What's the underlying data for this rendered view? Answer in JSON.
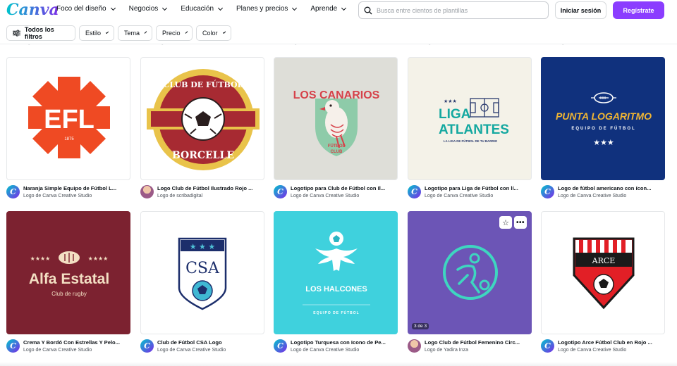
{
  "brand": {
    "name": "Canva"
  },
  "nav": [
    {
      "label": "Foco del diseño"
    },
    {
      "label": "Negocios"
    },
    {
      "label": "Educación"
    },
    {
      "label": "Planes y precios"
    },
    {
      "label": "Aprende"
    }
  ],
  "search": {
    "placeholder": "Busca entre cientos de plantillas",
    "icon": "search-icon"
  },
  "auth": {
    "login_label": "Iniciar sesión",
    "register_label": "Regístrate"
  },
  "filters": {
    "all_label": "Todos los filtros",
    "style_label": "Estilo",
    "theme_label": "Tema",
    "price_label": "Precio",
    "color_label": "Color"
  },
  "remnants": [
    "Logo de ... Studio",
    "Logo de Canva Creative Studio",
    "Logo de Canva Creative Studio",
    "Logo de Canva Creative Studio",
    "Logo de Canva Creative Studio"
  ],
  "cards": [
    {
      "title": "Naranja Simple Equipo de Fútbol L...",
      "author": "Logo de Canva Creative Studio",
      "thumb": {
        "text1": "EFL",
        "text2": "1875"
      }
    },
    {
      "title": "Logo Club de Fútbol Ilustrado Rojo ...",
      "author": "Logo de scribadigital",
      "thumb": {
        "text1": "CLUB DE FÚTBOL",
        "text2": "BORCELLE"
      }
    },
    {
      "title": "Logotipo para Club de Fútbol con Il...",
      "author": "Logo de Canva Creative Studio",
      "thumb": {
        "text1": "LOS CANARIOS",
        "text2": "FÚTBOL",
        "text3": "CLUB"
      }
    },
    {
      "title": "Logotipo para Liga de Fútbol con lí...",
      "author": "Logo de Canva Creative Studio",
      "thumb": {
        "text1": "LIGA",
        "text2": "ATLANTES",
        "text3": "LA LIGA DE FÚTBOL DE TU BARRIO"
      }
    },
    {
      "title": "Logo de fútbol americano con ícon...",
      "author": "Logo de Canva Creative Studio",
      "thumb": {
        "text1": "PUNTA LOGARITMO",
        "text2": "EQUIPO DE FÚTBOL"
      }
    },
    {
      "title": "Crema Y Bordó Con Estrellas Y Pelo...",
      "author": "Logo de Canva Creative Studio",
      "thumb": {
        "text1": "Alfa Estatal",
        "text2": "Club de rugby"
      }
    },
    {
      "title": "Club de Fútbol CSA Logo",
      "author": "Logo de Canva Creative Studio",
      "thumb": {
        "text1": "CSA"
      }
    },
    {
      "title": "Logotipo Turquesa con Icono de Pe...",
      "author": "Logo de Canva Creative Studio",
      "thumb": {
        "text1": "LOS HALCONES",
        "text2": "EQUIPO DE FÚTBOL"
      }
    },
    {
      "title": "Logo Club de Fútbol Femenino Circ...",
      "author": "Logo de Yadira Inza",
      "thumb": {
        "badge": "3 de 3"
      }
    },
    {
      "title": "Logotipo Arce Fútbol Club en Rojo ...",
      "author": "Logo de Canva Creative Studio",
      "thumb": {
        "text1": "ARCE"
      }
    }
  ],
  "colors": {
    "accent": "#8b3dff",
    "brand_gradient_start": "#00c4cc",
    "brand_gradient_end": "#7d2ae8"
  }
}
